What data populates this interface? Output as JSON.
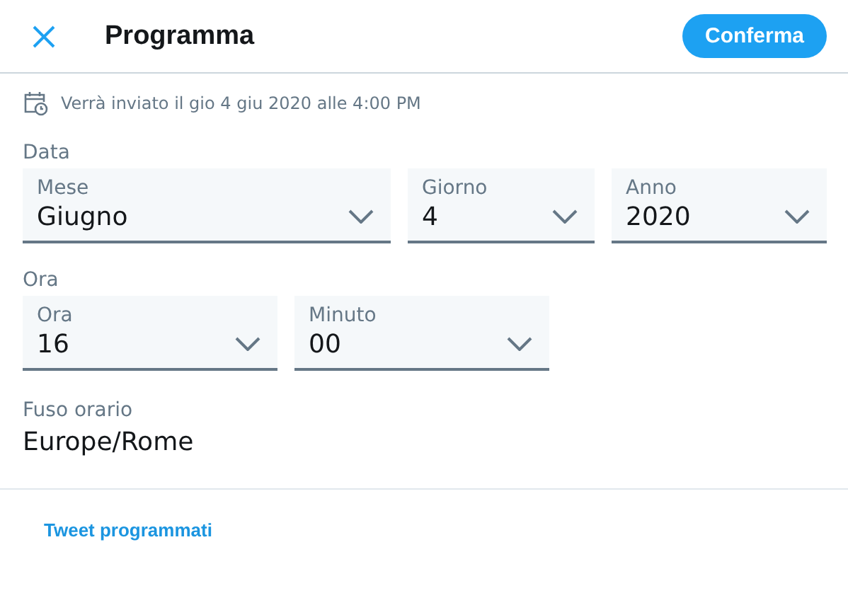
{
  "header": {
    "title": "Programma",
    "confirm_button": "Conferma"
  },
  "schedule_note": "Verrà inviato il gio 4 giu 2020 alle 4:00 PM",
  "sections": [
    {
      "label": "Data",
      "selects": [
        {
          "label": "Mese",
          "value": "Giugno"
        },
        {
          "label": "Giorno",
          "value": "4"
        },
        {
          "label": "Anno",
          "value": "2020"
        }
      ]
    },
    {
      "label": "Ora",
      "selects": [
        {
          "label": "Ora",
          "value": "16"
        },
        {
          "label": "Minuto",
          "value": "00"
        }
      ]
    }
  ],
  "timezone": {
    "label": "Fuso orario",
    "value": "Europe/Rome"
  },
  "footer_link": "Tweet programmati"
}
